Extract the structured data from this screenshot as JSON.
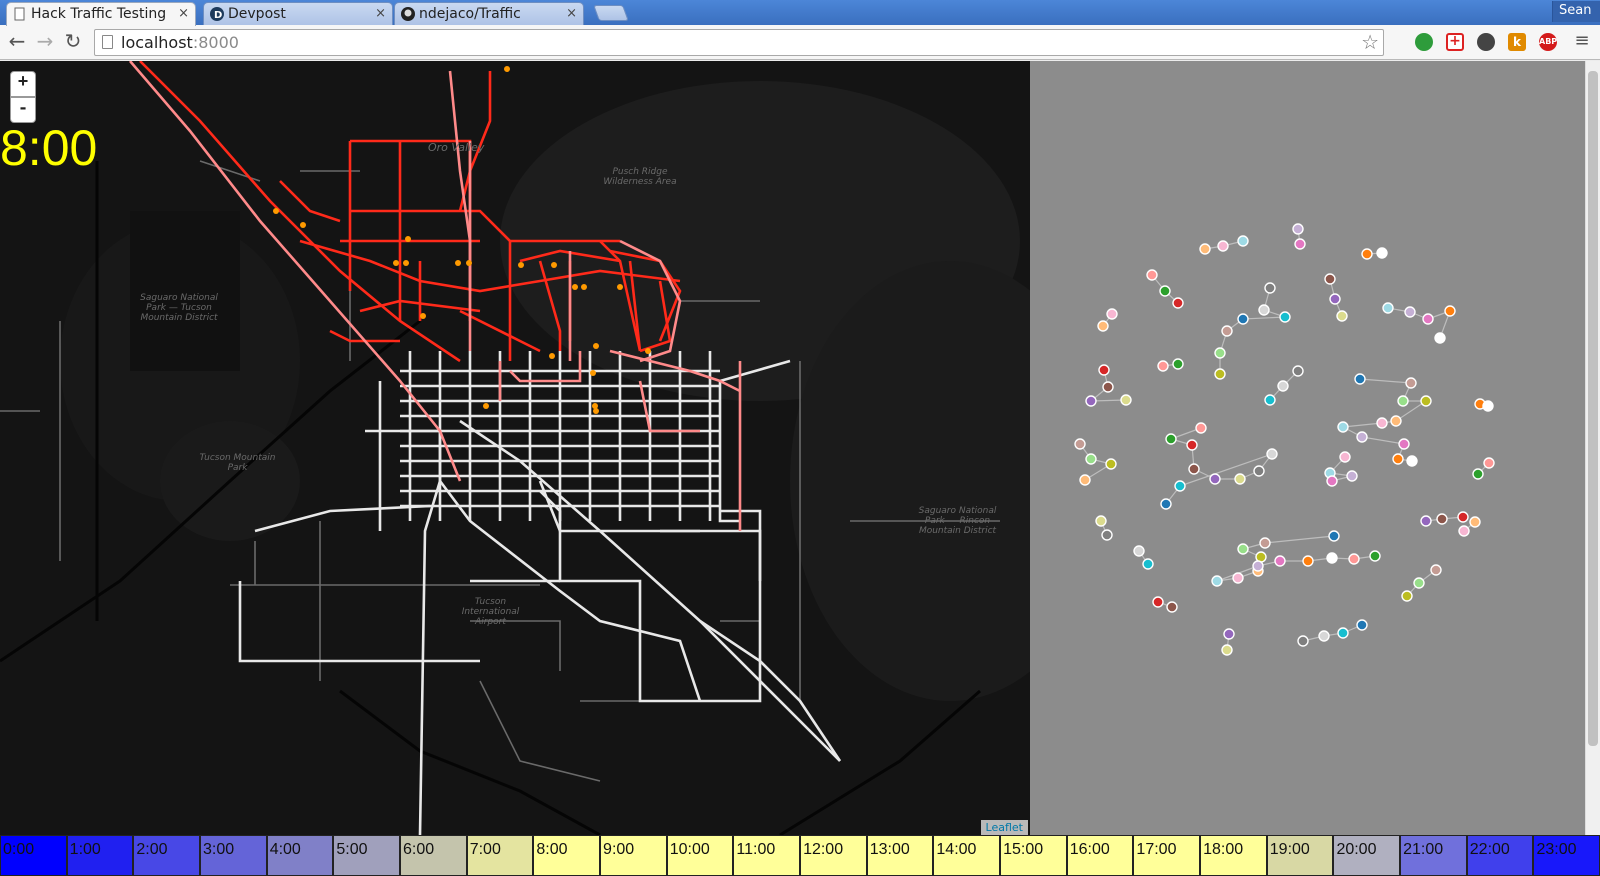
{
  "browser": {
    "tabs": [
      {
        "title": "Hack Traffic Testing",
        "icon": "page-icon",
        "active": true
      },
      {
        "title": "Devpost",
        "icon": "devpost-icon",
        "active": false
      },
      {
        "title": "ndejaco/Traffic",
        "icon": "github-icon",
        "active": false
      }
    ],
    "close_glyph": "×",
    "profile_name": "Sean",
    "url_host": "localhost",
    "url_port": ":8000"
  },
  "map": {
    "zoom_in_label": "+",
    "zoom_out_label": "-",
    "current_time": "8:00",
    "attribution": "Leaflet",
    "labels": {
      "oro_valley": "Oro Valley",
      "pusch_ridge": "Pusch Ridge Wilderness Area",
      "saguaro_west": "Saguaro National Park — Tucson Mountain District",
      "tucson_mountain": "Tucson Mountain Park",
      "saguaro_east": "Saguaro National Park — Rincon Mountain District",
      "airport": "Tucson International Airport"
    }
  },
  "timeline": {
    "hours": [
      "0:00",
      "1:00",
      "2:00",
      "3:00",
      "4:00",
      "5:00",
      "6:00",
      "7:00",
      "8:00",
      "9:00",
      "10:00",
      "11:00",
      "12:00",
      "13:00",
      "14:00",
      "15:00",
      "16:00",
      "17:00",
      "18:00",
      "19:00",
      "20:00",
      "21:00",
      "22:00",
      "23:00"
    ],
    "colors": [
      "#0000ff",
      "#2020f0",
      "#4848e6",
      "#6464d8",
      "#8080c8",
      "#a0a0bc",
      "#c4c4ac",
      "#e4e4a0",
      "#ffff99",
      "#ffff99",
      "#ffff99",
      "#ffff99",
      "#ffff99",
      "#ffff99",
      "#ffff99",
      "#ffff99",
      "#ffff99",
      "#ffff99",
      "#ffff99",
      "#d8d8a4",
      "#b0b0c0",
      "#7070dc",
      "#4040ec",
      "#1818fa"
    ]
  },
  "colors": {
    "time_display": "#ffff00",
    "graph_background": "#8c8c8c"
  }
}
